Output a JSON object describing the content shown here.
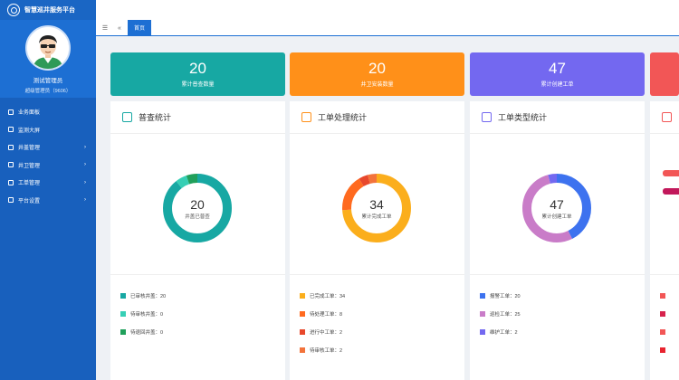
{
  "app": {
    "title": "智慧巡井服务平台"
  },
  "user": {
    "name": "测试管理员",
    "role": "超级管理员（9606）"
  },
  "menu": [
    {
      "label": "业务面板",
      "icon": "dashboard-icon",
      "arrow": ""
    },
    {
      "label": "监测大屏",
      "icon": "monitor-icon",
      "arrow": ""
    },
    {
      "label": "井盖管理",
      "icon": "manhole-icon",
      "arrow": "›"
    },
    {
      "label": "井卫管理",
      "icon": "guard-icon",
      "arrow": "›"
    },
    {
      "label": "工单管理",
      "icon": "workorder-icon",
      "arrow": "›"
    },
    {
      "label": "平台设置",
      "icon": "settings-icon",
      "arrow": "›"
    }
  ],
  "tabs": {
    "active": "首页"
  },
  "stats": [
    {
      "value": "20",
      "label": "累计普查数量",
      "color": "#17a8a3"
    },
    {
      "value": "20",
      "label": "井卫安装数量",
      "color": "#ff9019"
    },
    {
      "value": "47",
      "label": "累计创建工单",
      "color": "#7368f0"
    },
    {
      "value": "",
      "label": "",
      "color": "#f25656"
    }
  ],
  "panels": [
    {
      "title": "普查统计",
      "icon_color": "#17a8a3",
      "center_value": "20",
      "center_label": "井盖已普查",
      "segments": [
        {
          "value": 20,
          "color": "#17a8a3"
        },
        {
          "value": 1.2,
          "color": "#36cfb5"
        },
        {
          "value": 1.2,
          "color": "#20a05b"
        }
      ],
      "legend": [
        {
          "label": "已审核井盖：20",
          "color": "#17a8a3"
        },
        {
          "label": "待审核井盖：0",
          "color": "#36cfb5"
        },
        {
          "label": "待退回井盖：0",
          "color": "#20a05b"
        }
      ]
    },
    {
      "title": "工单处理统计",
      "icon_color": "#ff9019",
      "center_value": "34",
      "center_label": "累计完成工单",
      "segments": [
        {
          "value": 34,
          "color": "#fbae1c"
        },
        {
          "value": 8,
          "color": "#ff6a1f"
        },
        {
          "value": 2,
          "color": "#e8482c"
        },
        {
          "value": 2,
          "color": "#f3733b"
        }
      ],
      "legend": [
        {
          "label": "已完成工单：34",
          "color": "#fbae1c"
        },
        {
          "label": "待处理工单：8",
          "color": "#ff6a1f"
        },
        {
          "label": "进行中工单：2",
          "color": "#e8482c"
        },
        {
          "label": "待审核工单：2",
          "color": "#f3733b"
        }
      ]
    },
    {
      "title": "工单类型统计",
      "icon_color": "#7368f0",
      "center_value": "47",
      "center_label": "累计创建工单",
      "segments": [
        {
          "value": 20,
          "color": "#3d72ef"
        },
        {
          "value": 25,
          "color": "#c97cc8"
        },
        {
          "value": 2,
          "color": "#7368f0"
        }
      ],
      "legend": [
        {
          "label": "报警工单：20",
          "color": "#3d72ef"
        },
        {
          "label": "巡检工单：25",
          "color": "#c97cc8"
        },
        {
          "label": "维护工单：2",
          "color": "#7368f0"
        }
      ]
    },
    {
      "title": "",
      "icon_color": "#f25656",
      "center_value": "",
      "center_label": "",
      "segments": [],
      "legend": [
        {
          "label": "",
          "color": "#f25656"
        },
        {
          "label": "",
          "color": "#d7234d"
        },
        {
          "label": "",
          "color": "#f25656"
        },
        {
          "label": "",
          "color": "#e8242f"
        }
      ]
    }
  ]
}
